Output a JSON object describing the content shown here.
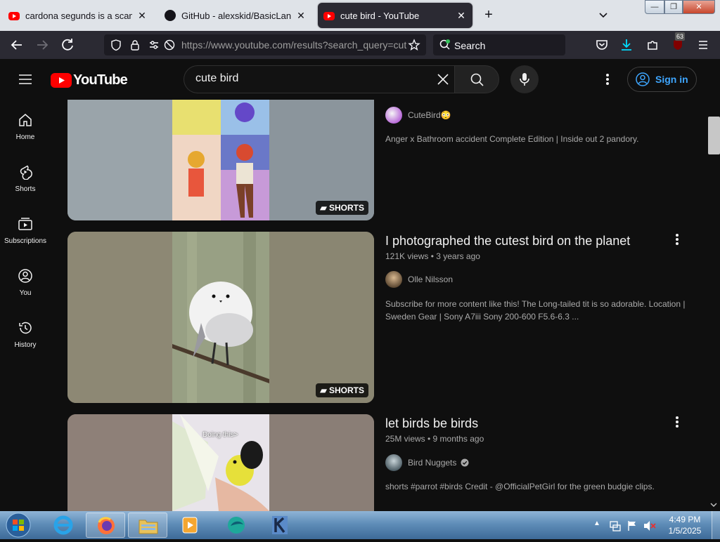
{
  "browser": {
    "tabs": [
      {
        "label": "cardona segunds is a scammer",
        "favicon": "youtube-favicon",
        "active": false
      },
      {
        "label": "GitHub - alexskid/BasicLang-SP",
        "favicon": "github-favicon",
        "active": false
      },
      {
        "label": "cute bird - YouTube",
        "favicon": "youtube-favicon",
        "active": true
      }
    ],
    "new_tab_label": "+",
    "window_controls": {
      "minimize": "—",
      "maximize": "❐",
      "close": "✕"
    },
    "url": "https://www.youtube.com/results?search_query=cute+bird",
    "search_placeholder": "Search",
    "extension_badge": "63"
  },
  "youtube": {
    "logo_text": "YouTube",
    "search_value": "cute bird",
    "sign_in_label": "Sign in",
    "sidebar": [
      {
        "label": "Home",
        "icon": "home-icon"
      },
      {
        "label": "Shorts",
        "icon": "shorts-icon"
      },
      {
        "label": "Subscriptions",
        "icon": "subscriptions-icon"
      },
      {
        "label": "You",
        "icon": "you-icon"
      },
      {
        "label": "History",
        "icon": "history-icon"
      }
    ],
    "results": [
      {
        "title": "",
        "meta": "",
        "channel": "CuteBird😳",
        "verified": false,
        "description": "Anger x Bathroom accident Complete Edition | Inside out 2 pandory.",
        "badge": "SHORTS"
      },
      {
        "title": "I photographed the cutest bird on the planet",
        "meta": "121K views • 3 years ago",
        "channel": "Olle Nilsson",
        "verified": false,
        "description": "Subscribe for more content like this! The Long-tailed tit is so adorable. Location | Sweden Gear | Sony A7iii Sony 200-600 F5.6-6.3 ...",
        "badge": "SHORTS"
      },
      {
        "title": "let birds be birds",
        "meta": "25M views • 9 months ago",
        "channel": "Bird Nuggets",
        "verified": true,
        "description": "shorts #parrot #birds Credit - @OfficialPetGirl for the green budgie clips.",
        "thumb_caption": "Doing this>"
      }
    ]
  },
  "taskbar": {
    "time": "4:49 PM",
    "date": "1/5/2025"
  },
  "colors": {
    "yt_red": "#ff0000",
    "link_blue": "#3ea6ff",
    "bg": "#0f0f0f"
  }
}
